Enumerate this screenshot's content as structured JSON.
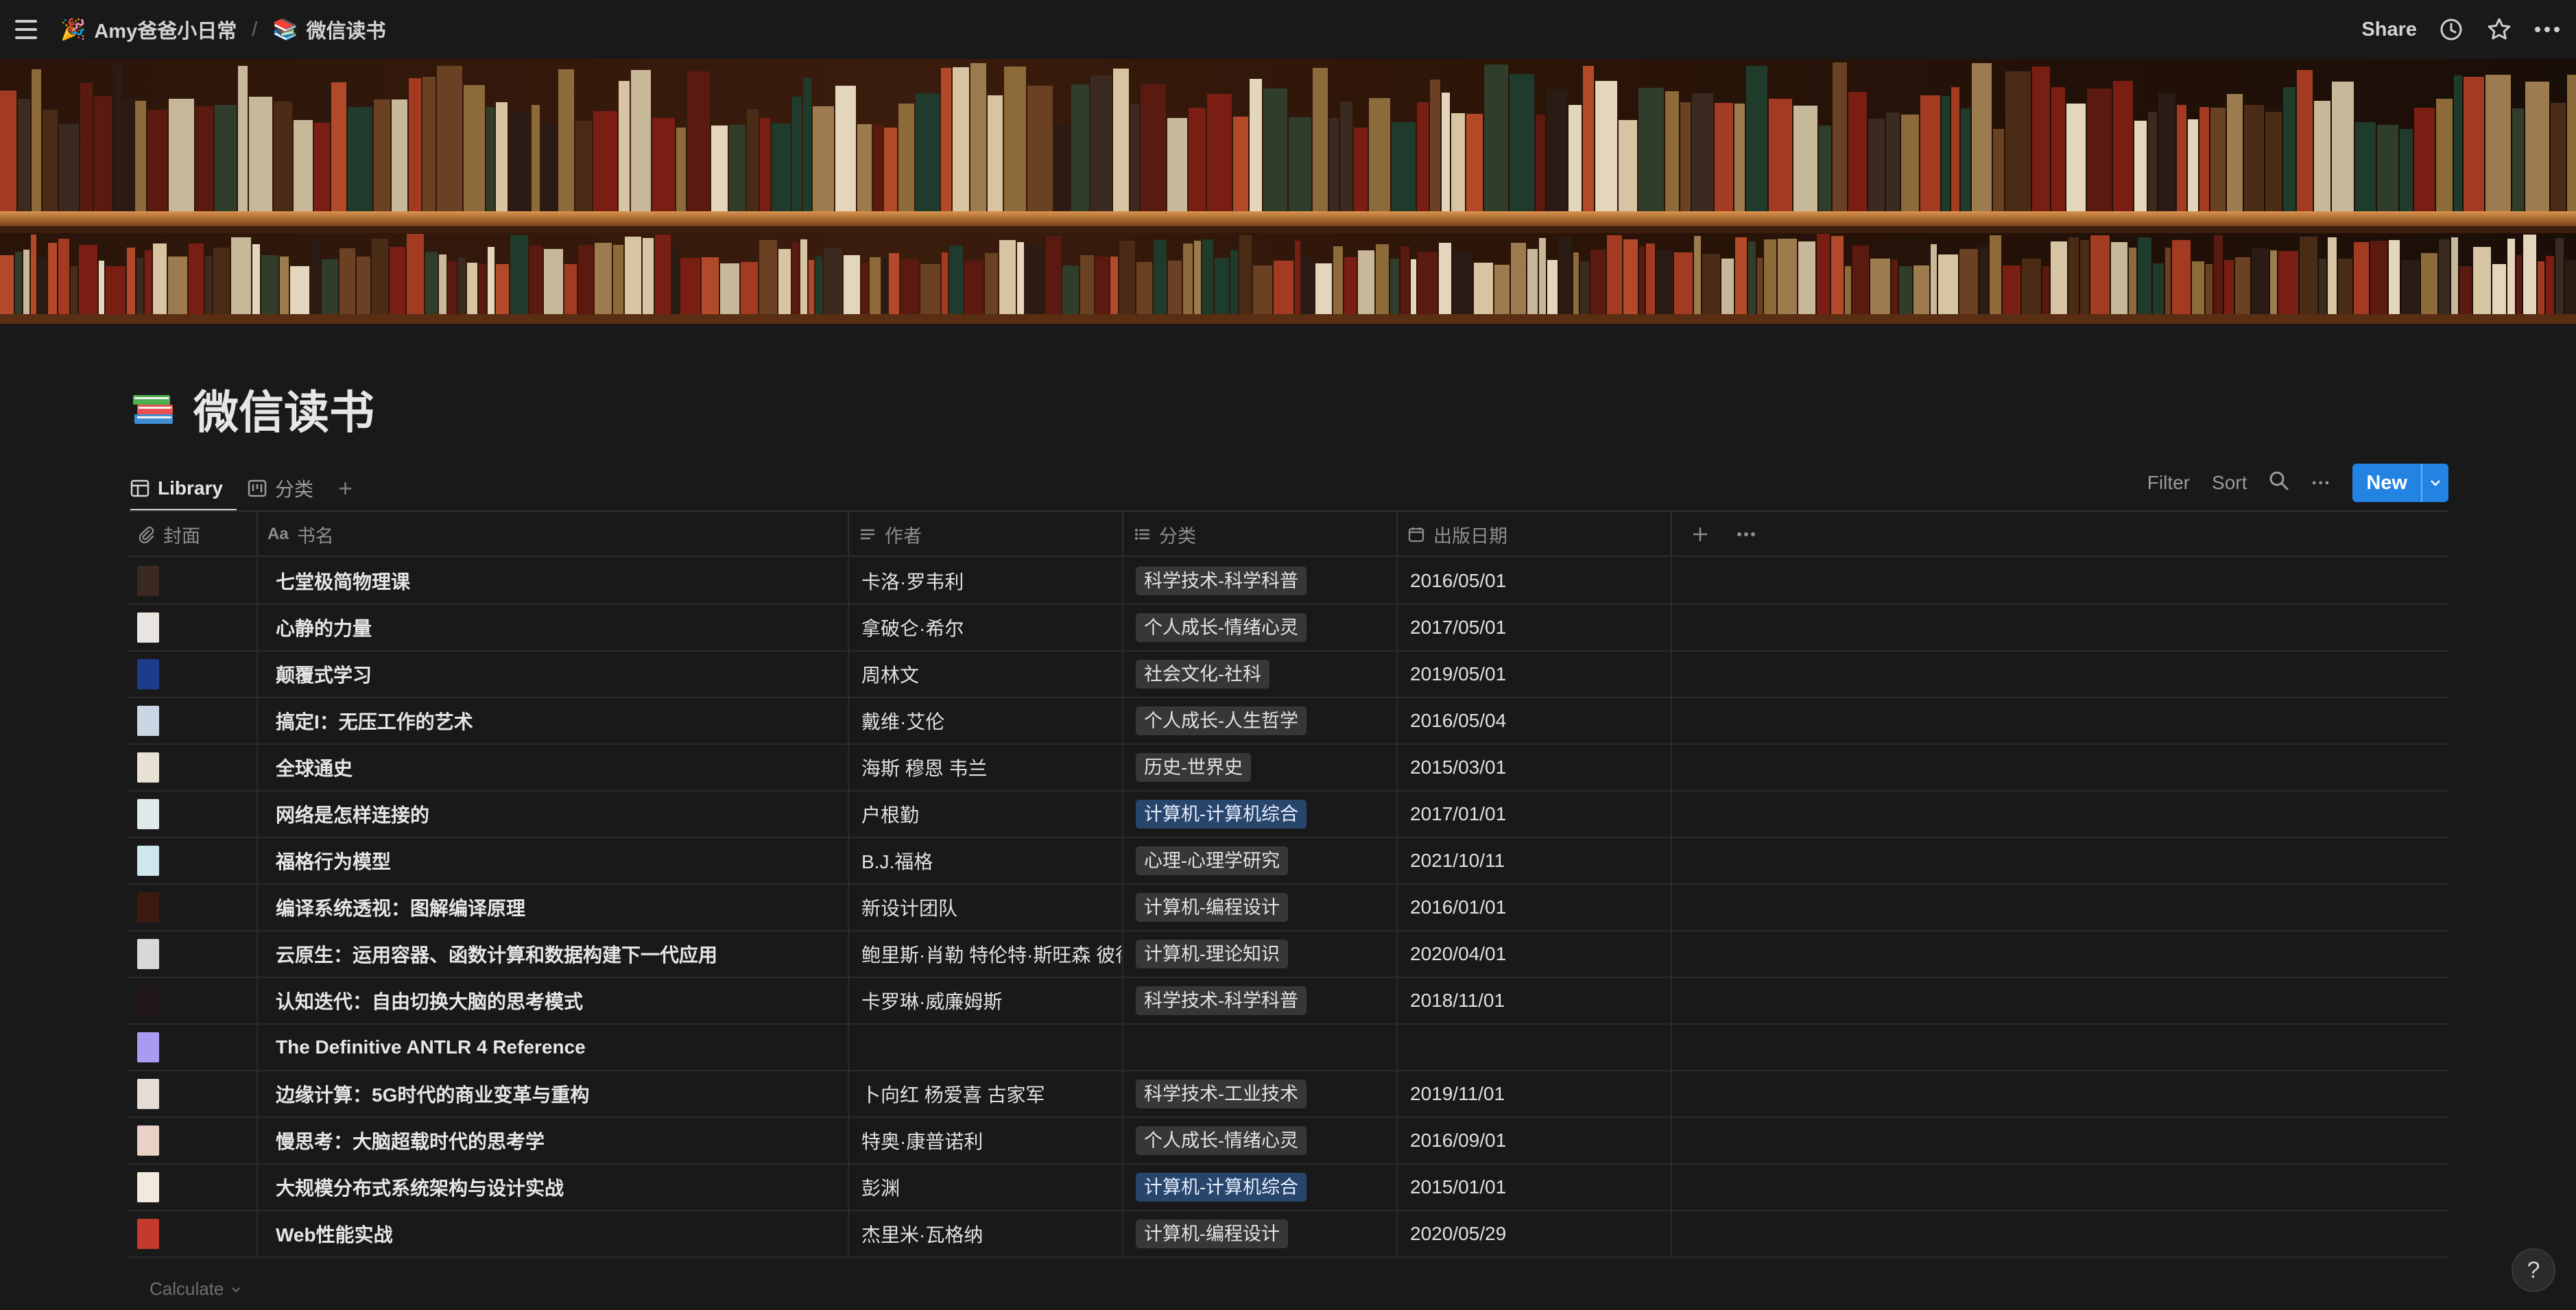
{
  "breadcrumb": {
    "workspace_emoji": "🎉",
    "workspace": "Amy爸爸小日常",
    "separator": "/",
    "page_emoji": "📚",
    "page": "微信读书"
  },
  "top_actions": {
    "share": "Share"
  },
  "icons": [
    "menu-icon",
    "clock-icon",
    "star-icon",
    "more-icon",
    "table-icon",
    "board-icon",
    "plus-icon",
    "search-icon",
    "chevron-down-icon",
    "paperclip-icon",
    "text-icon",
    "list-icon",
    "calendar-icon",
    "help-icon"
  ],
  "page": {
    "title": "微信读书",
    "icon": "books-icon"
  },
  "views": {
    "library": "Library",
    "category": "分类",
    "add": "+"
  },
  "toolbar": {
    "filter": "Filter",
    "sort": "Sort",
    "more": "···",
    "new": "New"
  },
  "columns": {
    "cover": "封面",
    "title": "书名",
    "author": "作者",
    "category": "分类",
    "date": "出版日期"
  },
  "rows": [
    {
      "cover_color": "#3a2a22",
      "title": "七堂极简物理课",
      "author": "卡洛·罗韦利",
      "category": "科学技术-科学科普",
      "tag_color": "gray",
      "date": "2016/05/01"
    },
    {
      "cover_color": "#e9e4df",
      "title": "心静的力量",
      "author": "拿破仑·希尔",
      "category": "个人成长-情绪心灵",
      "tag_color": "gray",
      "date": "2017/05/01"
    },
    {
      "cover_color": "#1d3c8a",
      "title": "颠覆式学习",
      "author": "周林文",
      "category": "社会文化-社科",
      "tag_color": "gray",
      "date": "2019/05/01"
    },
    {
      "cover_color": "#c9d6e3",
      "title": "搞定I：无压工作的艺术",
      "author": "戴维·艾伦",
      "category": "个人成长-人生哲学",
      "tag_color": "gray",
      "date": "2016/05/04"
    },
    {
      "cover_color": "#e7e2d4",
      "title": "全球通史",
      "author": "海斯 穆恩 韦兰",
      "category": "历史-世界史",
      "tag_color": "gray",
      "date": "2015/03/01"
    },
    {
      "cover_color": "#dfe8ea",
      "title": "网络是怎样连接的",
      "author": "户根勤",
      "category": "计算机-计算机综合",
      "tag_color": "blue",
      "date": "2017/01/01"
    },
    {
      "cover_color": "#cfe6ec",
      "title": "福格行为模型",
      "author": "B.J.福格",
      "category": "心理-心理学研究",
      "tag_color": "gray",
      "date": "2021/10/11"
    },
    {
      "cover_color": "#3b1a12",
      "title": "编译系统透视：图解编译原理",
      "author": "新设计团队",
      "category": "计算机-编程设计",
      "tag_color": "gray",
      "date": "2016/01/01"
    },
    {
      "cover_color": "#d8d8d8",
      "title": "云原生：运用容器、函数计算和数据构建下一代应用",
      "author": "鲍里斯·肖勒 特伦特·斯旺森 彼得",
      "category": "计算机-理论知识",
      "tag_color": "gray",
      "date": "2020/04/01"
    },
    {
      "cover_color": "#201818",
      "title": "认知迭代：自由切换大脑的思考模式",
      "author": "卡罗琳·威廉姆斯",
      "category": "科学技术-科学科普",
      "tag_color": "gray",
      "date": "2018/11/01"
    },
    {
      "cover_color": "#a99bf2",
      "title": "The Definitive ANTLR 4 Reference",
      "author": "",
      "category": "",
      "tag_color": "none",
      "date": ""
    },
    {
      "cover_color": "#e6dcd6",
      "title": "边缘计算：5G时代的商业变革与重构",
      "author": "卜向红 杨爱喜 古家军",
      "category": "科学技术-工业技术",
      "tag_color": "gray",
      "date": "2019/11/01"
    },
    {
      "cover_color": "#e8d2c8",
      "title": "慢思考：大脑超载时代的思考学",
      "author": "特奥·康普诺利",
      "category": "个人成长-情绪心灵",
      "tag_color": "gray",
      "date": "2016/09/01"
    },
    {
      "cover_color": "#f2e8dc",
      "title": "大规模分布式系统架构与设计实战",
      "author": "彭渊",
      "category": "计算机-计算机综合",
      "tag_color": "blue",
      "date": "2015/01/01"
    },
    {
      "cover_color": "#c43a2e",
      "title": "Web性能实战",
      "author": "杰里米·瓦格纳",
      "category": "计算机-编程设计",
      "tag_color": "gray",
      "date": "2020/05/29"
    }
  ],
  "footer": {
    "calculate": "Calculate",
    "help": "?"
  }
}
